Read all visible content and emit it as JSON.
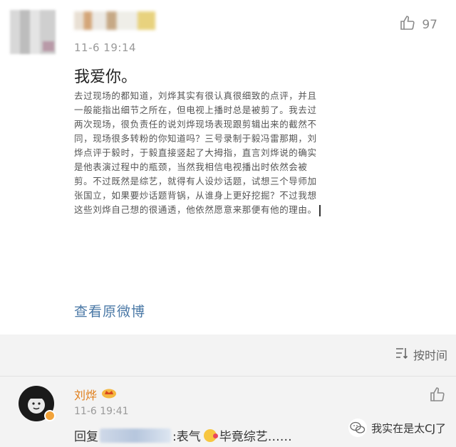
{
  "post": {
    "timestamp": "11-6 19:14",
    "like_count": "97",
    "text": "我爱你。",
    "quoted_text": "去过现场的都知道，刘烨其实有很认真很细致的点评，并且一般能指出细节之所在，但电视上播时总是被剪了。我去过两次现场，很负责任的说刘烨现场表现跟剪辑出来的截然不同，现场很多转粉的你知道吗？三号录制于毅冯雷那期，刘烨点评于毅时，于毅直接竖起了大拇指，直言刘烨说的确实是他表演过程中的瓶颈，当然我相信电视播出时依然会被剪。不过既然是综艺，就得有人设炒话题，试想三个导师加张国立，如果要炒话题背锅，从谁身上更好挖掘？不过我想这些刘烨自己想的很通透，他依然愿意来那便有他的理由。",
    "view_original_label": "查看原微博"
  },
  "comments_header": {
    "sort_label": "按时间"
  },
  "comment": {
    "author": "刘烨",
    "timestamp": "11-6 19:41",
    "reply_prefix": "回复",
    "reply_text_a": ":表气",
    "reply_text_b": "毕竟综艺……"
  },
  "watermark": {
    "text": "我实在是太CJ了"
  },
  "icons": {
    "like": "thumbs-up-icon",
    "sort": "sort-icon",
    "verified": "verified-badge-icon",
    "wechat": "wechat-logo-icon"
  },
  "colors": {
    "link": "#4a78a6",
    "author": "#e0801e"
  }
}
